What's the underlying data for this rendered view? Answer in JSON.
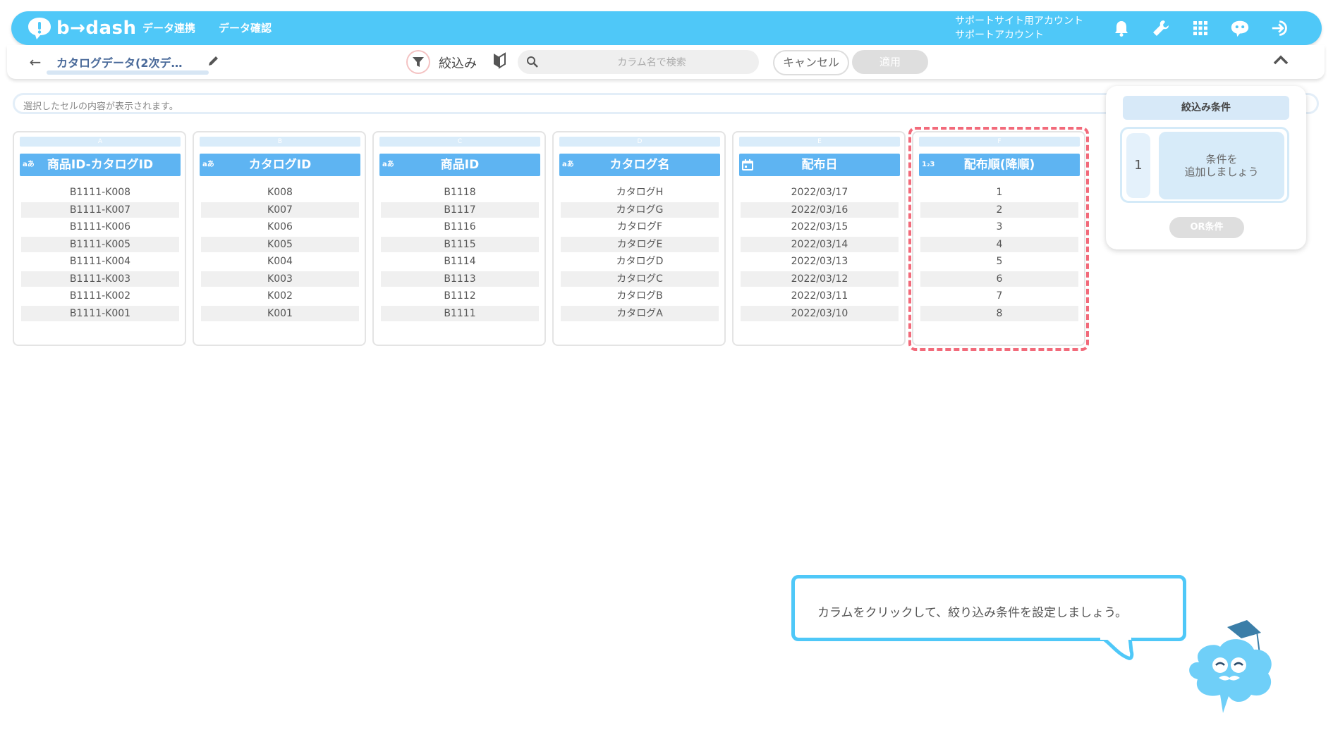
{
  "header": {
    "logo_text": "b→dash",
    "nav": [
      "データ連携",
      "データ確認"
    ],
    "account_line1": "サポートサイト用アカウント",
    "account_line2": "サポートアカウント",
    "icons": [
      "bell-icon",
      "wrench-icon",
      "apps-grid-icon",
      "chat-bot-icon",
      "logout-icon"
    ]
  },
  "toolbar": {
    "title": "カタログデータ(2次デ…",
    "filter_label": "絞込み",
    "search_placeholder": "カラム名で検索",
    "cancel_label": "キャンセル",
    "apply_label": "適用"
  },
  "cellbar": {
    "placeholder_text": "選択したセルの内容が表示されます。"
  },
  "columns": [
    {
      "letter": "A",
      "type": "aあ",
      "name": "商品ID-カタログID",
      "cells": [
        "B1111-K008",
        "B1111-K007",
        "B1111-K006",
        "B1111-K005",
        "B1111-K004",
        "B1111-K003",
        "B1111-K002",
        "B1111-K001"
      ]
    },
    {
      "letter": "B",
      "type": "aあ",
      "name": "カタログID",
      "cells": [
        "K008",
        "K007",
        "K006",
        "K005",
        "K004",
        "K003",
        "K002",
        "K001"
      ]
    },
    {
      "letter": "C",
      "type": "aあ",
      "name": "商品ID",
      "cells": [
        "B1118",
        "B1117",
        "B1116",
        "B1115",
        "B1114",
        "B1113",
        "B1112",
        "B1111"
      ]
    },
    {
      "letter": "D",
      "type": "aあ",
      "name": "カタログ名",
      "cells": [
        "カタログH",
        "カタログG",
        "カタログF",
        "カタログE",
        "カタログD",
        "カタログC",
        "カタログB",
        "カタログA"
      ]
    },
    {
      "letter": "E",
      "type": "calendar",
      "name": "配布日",
      "cells": [
        "2022/03/17",
        "2022/03/16",
        "2022/03/15",
        "2022/03/14",
        "2022/03/13",
        "2022/03/12",
        "2022/03/11",
        "2022/03/10"
      ]
    },
    {
      "letter": "F",
      "type": "1₂3",
      "name": "配布順(降順)",
      "cells": [
        "1",
        "2",
        "3",
        "4",
        "5",
        "6",
        "7",
        "8"
      ]
    }
  ],
  "filter_panel": {
    "title": "絞込み条件",
    "condition_number": "1",
    "add_line1": "条件を",
    "add_line2": "追加しましょう",
    "or_button": "OR条件"
  },
  "tooltip": {
    "text": "カラムをクリックして、絞り込み条件を設定しましょう。"
  },
  "colors": {
    "brand": "#4fc8f8",
    "column_header": "#5eb4f2",
    "highlight": "#f26a7a"
  }
}
